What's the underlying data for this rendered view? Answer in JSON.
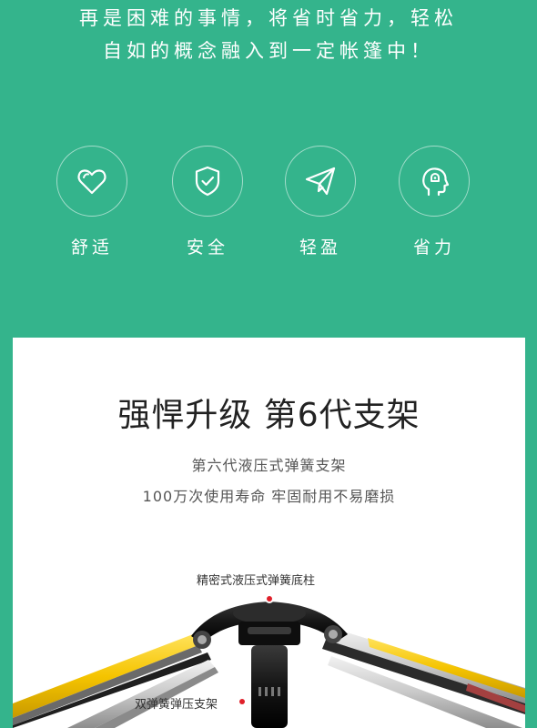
{
  "hero": {
    "line1": "再是困难的事情，将省时省力，轻松",
    "line2": "自如的概念融入到一定帐篷中！"
  },
  "features": [
    {
      "label": "舒适",
      "icon": "heart-icon"
    },
    {
      "label": "安全",
      "icon": "shield-check-icon"
    },
    {
      "label": "轻盈",
      "icon": "paper-plane-icon"
    },
    {
      "label": "省力",
      "icon": "head-profile-icon"
    }
  ],
  "card": {
    "title": "强悍升级 第6代支架",
    "subtitle1": "第六代液压式弹簧支架",
    "subtitle2": "100万次使用寿命 牢固耐用不易磨损",
    "annotation_top": "精密式液压式弹簧底柱",
    "annotation_bottom": "双弹簧弹压支架"
  },
  "colors": {
    "background": "#34b48c",
    "card": "#ffffff",
    "pole_yellow": "#f5c400",
    "pole_silver": "#c9c9c9",
    "hub": "#1c1c1c",
    "marker": "#e0202a"
  }
}
